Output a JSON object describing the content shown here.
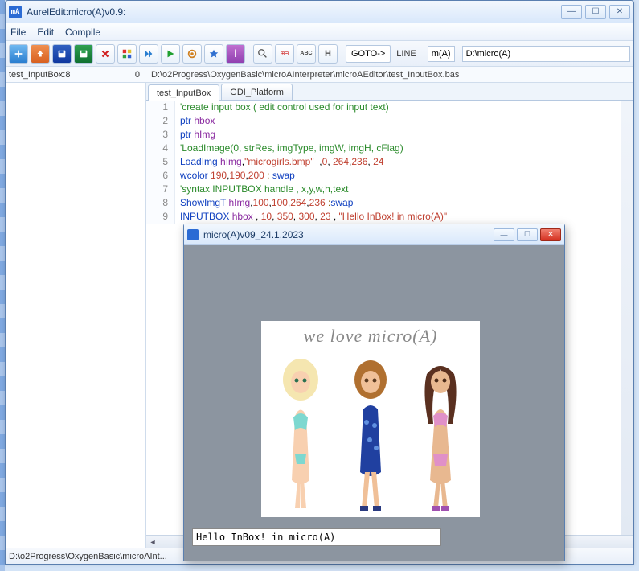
{
  "window": {
    "title": "AurelEdit:micro(A)v0.9:",
    "icon_label": "mA"
  },
  "menus": [
    "File",
    "Edit",
    "Compile"
  ],
  "toolbar": {
    "goto_label": "GOTO->",
    "line_label": "LINE",
    "macro_button": "m(A)",
    "path_field": "D:\\micro(A)"
  },
  "status_row": {
    "left_label": "test_InputBox:8",
    "left_value": "0",
    "file_path": "D:\\o2Progress\\OxygenBasic\\microAInterpreter\\microAEditor\\test_InputBox.bas"
  },
  "tabs": [
    {
      "label": "test_InputBox",
      "active": true
    },
    {
      "label": "GDI_Platform",
      "active": false
    }
  ],
  "code_lines": [
    {
      "n": 1,
      "html": "<span class='c-comment'>'create input box ( edit control used for input text)</span>"
    },
    {
      "n": 2,
      "html": "<span class='c-keyword'>ptr</span> <span class='c-ident'>hbox</span>"
    },
    {
      "n": 3,
      "html": "<span class='c-keyword'>ptr</span> <span class='c-ident'>hImg</span>"
    },
    {
      "n": 4,
      "html": "<span class='c-comment'>'LoadImage(0, strRes, imgType, imgW, imgH, cFlag)</span>"
    },
    {
      "n": 5,
      "html": "<span class='c-keyword'>LoadImg</span> <span class='c-ident'>hImg</span>,<span class='c-str'>\"microgirls.bmp\"</span>  ,<span class='c-num'>0</span>, <span class='c-num'>264</span>,<span class='c-num'>236</span>, <span class='c-num'>24</span>"
    },
    {
      "n": 6,
      "html": "<span class='c-keyword'>wcolor</span> <span class='c-num'>190</span>,<span class='c-num'>190</span>,<span class='c-num'>200</span> <span class='c-op'>:</span> <span class='c-keyword'>swap</span>"
    },
    {
      "n": 7,
      "html": "<span class='c-comment'>'syntax INPUTBOX handle , x,y,w,h,text</span>"
    },
    {
      "n": 8,
      "html": "<span class='c-keyword'>ShowImgT</span> <span class='c-ident'>hImg</span>,<span class='c-num'>100</span>,<span class='c-num'>100</span>,<span class='c-num'>264</span>,<span class='c-num'>236</span> <span class='c-op'>:</span><span class='c-keyword'>swap</span>"
    },
    {
      "n": 9,
      "html": "<span class='c-keyword'>INPUTBOX</span> <span class='c-ident'>hbox</span> , <span class='c-num'>10</span>, <span class='c-num'>350</span>, <span class='c-num'>300</span>, <span class='c-num'>23</span> , <span class='c-str'>\"Hello InBox! in micro(A)\"</span>"
    }
  ],
  "bottom_status": "D:\\o2Progress\\OxygenBasic\\microAInt...",
  "child_window": {
    "title": "micro(A)v09_24.1.2023",
    "image_caption": "we love micro(A)",
    "input_value": "Hello InBox! in micro(A)"
  },
  "icons": {
    "new": "plus",
    "open": "up-arrow",
    "save": "disk",
    "saveall": "disk-plus",
    "close": "x-red",
    "colors": "diamonds",
    "run": "play-blue",
    "compile": "play-green",
    "settings": "gear",
    "star": "star",
    "info": "info",
    "find": "magnifier",
    "toggle": "switch",
    "abc": "abc",
    "hide": "H"
  }
}
